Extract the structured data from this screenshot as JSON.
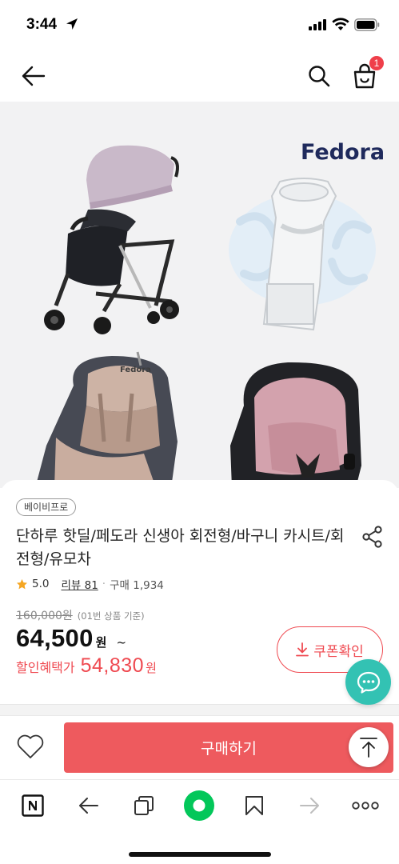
{
  "status_bar": {
    "time": "3:44"
  },
  "header": {
    "cart_count": "1"
  },
  "product_image": {
    "brand": "Fedora"
  },
  "product": {
    "category": "베이비프로",
    "title": "단하루 핫딜/페도라 신생아 회전형/바구니 카시트/회전형/유모차",
    "rating": "5.0",
    "review_label": "리뷰 81",
    "purchase_label": "구매 1,934",
    "original_price": "160,000원",
    "original_note": "(01번 상품 기준)",
    "price": "64,500",
    "price_unit": "원",
    "price_tilde": "~",
    "discount_label": "할인혜택가",
    "discount_price": "54,830",
    "discount_unit": "원",
    "coupon_label": "쿠폰확인"
  },
  "buy_bar": {
    "buy_label": "구매하기"
  },
  "colors": {
    "accent_red": "#ee5a5e",
    "chat_teal": "#33c2b3",
    "naver_green": "#03c75a",
    "brand_navy": "#1f2a5c"
  },
  "icons": {
    "status": [
      "location-arrow-icon",
      "signal-icon",
      "wifi-icon",
      "battery-icon"
    ],
    "header": [
      "back-arrow-icon",
      "search-icon",
      "cart-icon"
    ],
    "toolbar": [
      "naver-n-icon",
      "back-icon",
      "tabs-icon",
      "home-green-icon",
      "bookmark-icon",
      "forward-icon",
      "more-icon"
    ]
  }
}
